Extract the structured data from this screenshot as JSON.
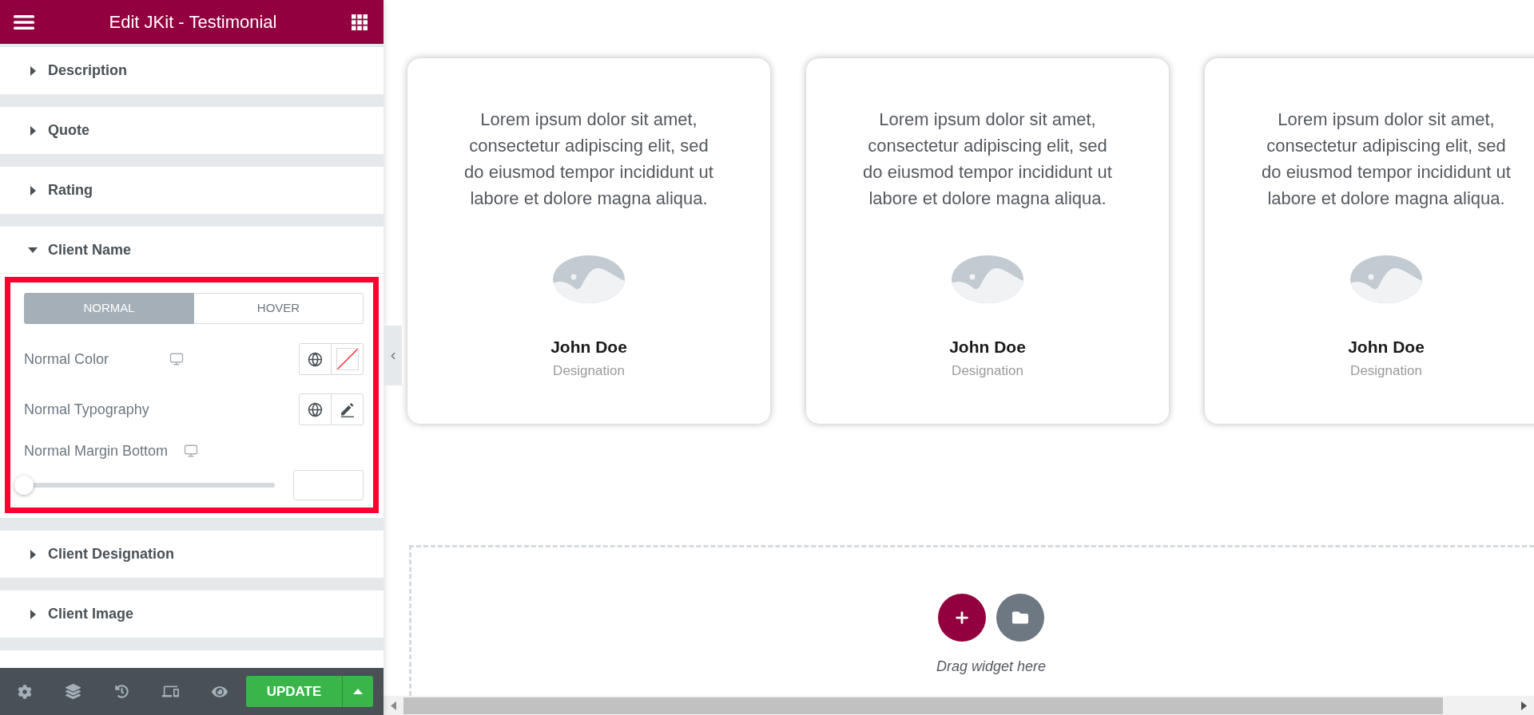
{
  "panel": {
    "title": "Edit JKit - Testimonial",
    "sections": [
      {
        "label": "Description",
        "expanded": false
      },
      {
        "label": "Quote",
        "expanded": false
      },
      {
        "label": "Rating",
        "expanded": false
      },
      {
        "label": "Client Name",
        "expanded": true,
        "content": {
          "highlighted": true,
          "tabs": [
            {
              "label": "NORMAL",
              "selected": true
            },
            {
              "label": "HOVER",
              "selected": false
            }
          ],
          "controls": [
            {
              "kind": "color",
              "label": "Normal Color",
              "responsive": true
            },
            {
              "kind": "typography",
              "label": "Normal Typography",
              "responsive": false
            },
            {
              "kind": "slider",
              "label": "Normal Margin Bottom",
              "responsive": true,
              "level": 0
            }
          ]
        }
      },
      {
        "label": "Client Designation",
        "expanded": false
      },
      {
        "label": "Client Image",
        "expanded": false
      }
    ],
    "footer": {
      "update_label": "UPDATE"
    }
  },
  "canvas": {
    "cards": [
      {
        "quote": "Lorem ipsum dolor sit amet, consectetur adipiscing elit, sed do eiusmod tempor incididunt ut labore et dolore magna aliqua.",
        "name": "John Doe",
        "designation": "Designation"
      },
      {
        "quote": "Lorem ipsum dolor sit amet, consectetur adipiscing elit, sed do eiusmod tempor incididunt ut labore et dolore magna aliqua.",
        "name": "John Doe",
        "designation": "Designation"
      },
      {
        "quote": "Lorem ipsum dolor sit amet, consectetur adipiscing elit, sed do eiusmod tempor incididunt ut labore et dolore magna aliqua.",
        "name": "John Doe",
        "designation": "Designation"
      }
    ],
    "drop_zone": {
      "hint": "Drag widget here"
    }
  }
}
